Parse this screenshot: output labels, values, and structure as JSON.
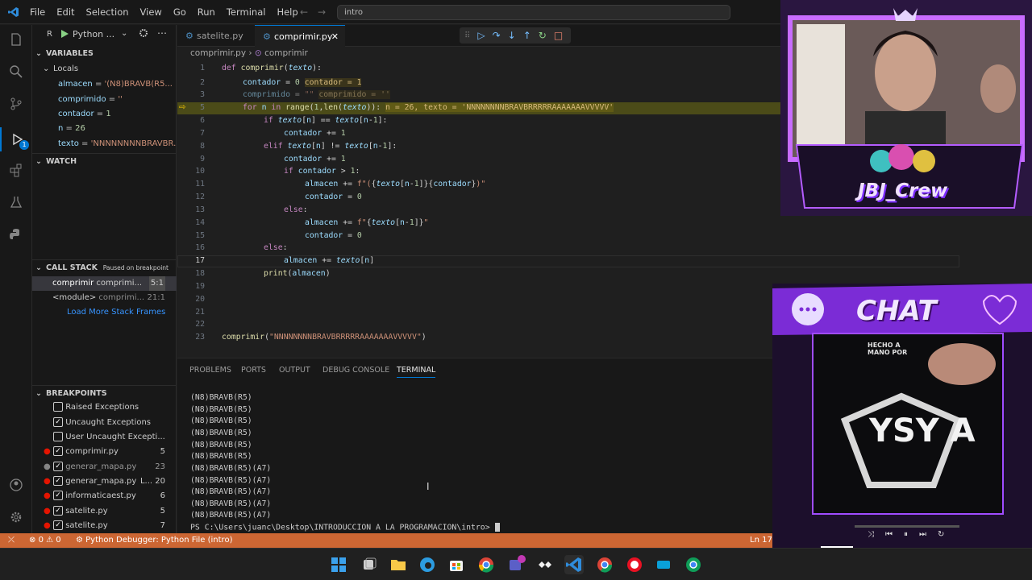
{
  "menu": [
    "File",
    "Edit",
    "Selection",
    "View",
    "Go",
    "Run",
    "Terminal",
    "Help"
  ],
  "command_center": "intro",
  "debug": {
    "config_label": "Python ..."
  },
  "tabs": [
    {
      "label": "satelite.py"
    },
    {
      "label": "comprimir.py"
    }
  ],
  "breadcrumb": {
    "file": "comprimir.py",
    "symbol": "comprimir"
  },
  "variables": {
    "title": "VARIABLES",
    "locals_title": "Locals",
    "items": [
      {
        "name": "almacen",
        "value": "'(N8)BRAVB(R5..."
      },
      {
        "name": "comprimido",
        "value": "''"
      },
      {
        "name": "contador",
        "value": "1"
      },
      {
        "name": "n",
        "value": "26"
      },
      {
        "name": "texto",
        "value": "'NNNNNNNNBRAVBR..."
      }
    ]
  },
  "watch_title": "WATCH",
  "callstack": {
    "title": "CALL STACK",
    "status": "Paused on breakpoint",
    "frames": [
      {
        "name": "comprimir",
        "file": "comprimi...",
        "pos": "5:1"
      },
      {
        "name": "<module>",
        "file": "comprimi...",
        "pos": "21:1"
      }
    ],
    "load_more": "Load More Stack Frames"
  },
  "breakpoints": {
    "title": "BREAKPOINTS",
    "items": [
      {
        "label": "Raised Exceptions",
        "checked": false,
        "count": ""
      },
      {
        "label": "Uncaught Exceptions",
        "checked": true,
        "count": ""
      },
      {
        "label": "User Uncaught Excepti...",
        "checked": false,
        "count": ""
      },
      {
        "label": "comprimir.py",
        "checked": true,
        "count": "5"
      },
      {
        "label": "generar_mapa.py",
        "checked": true,
        "count": "23"
      },
      {
        "label": "generar_mapa.py",
        "checked": true,
        "count": "L... 20"
      },
      {
        "label": "informaticaest.py",
        "checked": true,
        "count": "6"
      },
      {
        "label": "satelite.py",
        "checked": true,
        "count": "5"
      },
      {
        "label": "satelite.py",
        "checked": true,
        "count": "7"
      }
    ]
  },
  "editor": {
    "line_numbers": [
      "1",
      "2",
      "3",
      "5",
      "6",
      "7",
      "8",
      "9",
      "10",
      "11",
      "12",
      "13",
      "14",
      "15",
      "16",
      "17",
      "18",
      "19",
      "20",
      "21",
      "22",
      "23"
    ]
  },
  "inline_values": {
    "l2": "contador = 1",
    "l3": "comprimido = ''",
    "l5": "n = 26, texto = 'NNNNNNNNBRAVBRRRRRAAAAAAAVVVVV'"
  },
  "panel": {
    "tabs": [
      "PROBLEMS",
      "PORTS",
      "OUTPUT",
      "DEBUG CONSOLE",
      "TERMINAL"
    ],
    "terminal_lines": [
      "(N8)BRAVB(R5)",
      "(N8)BRAVB(R5)",
      "(N8)BRAVB(R5)",
      "(N8)BRAVB(R5)",
      "(N8)BRAVB(R5)",
      "(N8)BRAVB(R5)",
      "(N8)BRAVB(R5)(A7)",
      "(N8)BRAVB(R5)(A7)",
      "(N8)BRAVB(R5)(A7)",
      "(N8)BRAVB(R5)(A7)",
      "(N8)BRAVB(R5)(A7)"
    ],
    "prompt": "PS C:\\Users\\juanc\\Desktop\\INTRODUCCION A LA PROGRAMACION\\intro>"
  },
  "status": {
    "errors": "0",
    "warnings": "0",
    "debugger": "Python Debugger: Python File (intro)",
    "position": "Ln 17,"
  },
  "overlay": {
    "crew": "JBJ_Crew",
    "chat": "CHAT",
    "shirt_top": "HECHO A",
    "shirt_top2": "MANO POR",
    "shirt_brand": "YSY A"
  },
  "colors": {
    "statusbar": "#cc6633",
    "accent": "#0078d4"
  }
}
